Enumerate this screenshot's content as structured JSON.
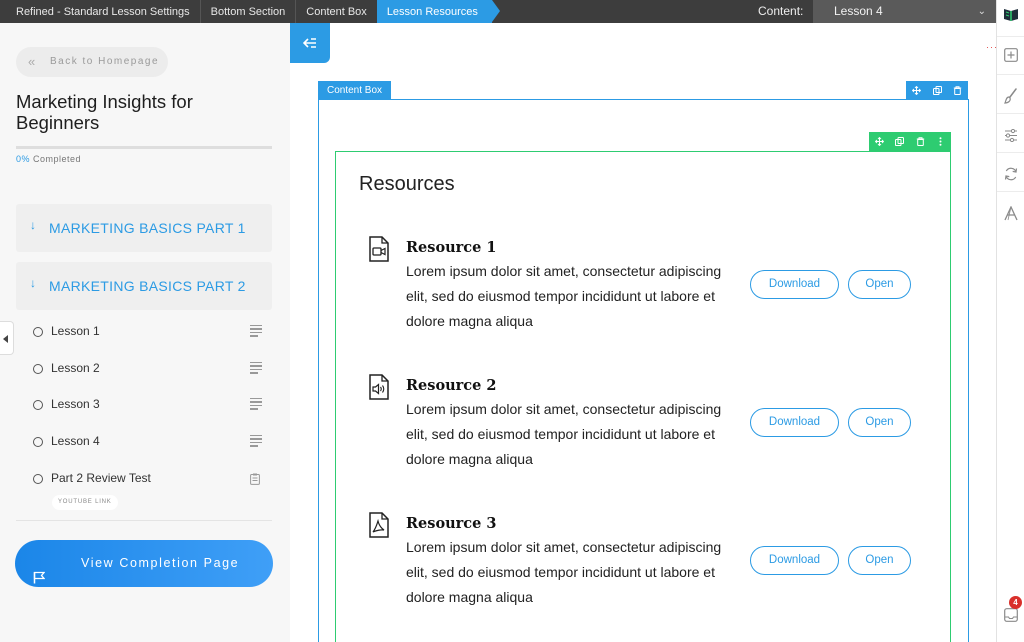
{
  "topbar": {
    "crumbs": [
      "Refined - Standard Lesson Settings",
      "Bottom Section",
      "Content Box",
      "Lesson Resources"
    ],
    "content_label": "Content:",
    "content_value": "Lesson 4"
  },
  "sidebar": {
    "back_label": "Back to Homepage",
    "course_title": "Marketing Insights for Beginners",
    "progress_percent": "0%",
    "progress_fraction": 0,
    "progress_label": "Completed",
    "modules": [
      "MARKETING BASICS PART 1",
      "MARKETING BASICS PART 2"
    ],
    "lessons": [
      "Lesson 1",
      "Lesson 2",
      "Lesson 3",
      "Lesson 4",
      "Part 2 Review Test"
    ],
    "youtube_tag": "YOUTUBE LINK",
    "completion_button": "View Completion Page"
  },
  "editor": {
    "box_tag": "Content Box"
  },
  "resources": {
    "heading": "Resources",
    "items": [
      {
        "title": "Resource 1",
        "description": "Lorem ipsum dolor sit amet, consectetur adipiscing elit, sed do eiusmod tempor incididunt ut labore et dolore magna aliqua",
        "icon": "video-file-icon",
        "download": "Download",
        "open": "Open"
      },
      {
        "title": "Resource 2",
        "description": "Lorem ipsum dolor sit amet, consectetur adipiscing elit, sed do eiusmod tempor incididunt ut labore et dolore magna aliqua",
        "icon": "audio-file-icon",
        "download": "Download",
        "open": "Open"
      },
      {
        "title": "Resource 3",
        "description": "Lorem ipsum dolor sit amet, consectetur adipiscing elit, sed do eiusmod tempor incididunt ut labore et dolore magna aliqua",
        "icon": "pdf-file-icon",
        "download": "Download",
        "open": "Open"
      }
    ]
  },
  "rail": {
    "notification_count": "4"
  },
  "colors": {
    "accent": "#2c9be4",
    "green": "#2ecc71",
    "topbar": "#3d3d3d",
    "badge": "#d9302b"
  }
}
